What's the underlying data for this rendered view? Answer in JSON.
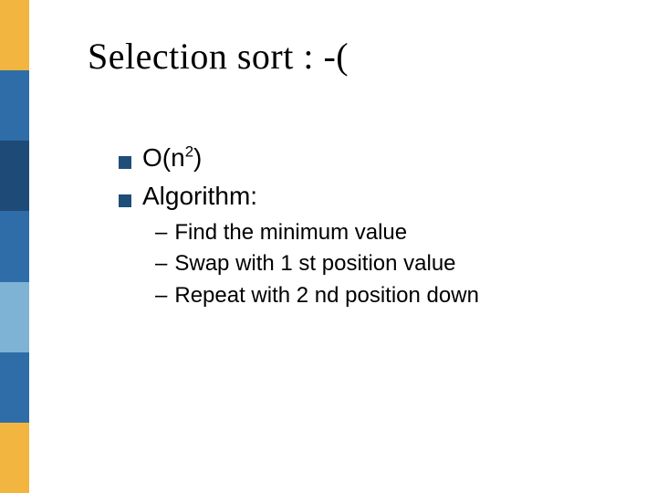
{
  "title": "Selection sort : -(",
  "bullets": {
    "b1": {
      "prefix": "O(n",
      "sup": "2",
      "suffix": ")"
    },
    "b2": "Algorithm:"
  },
  "subs": {
    "s1": "Find the minimum value",
    "s2": "Swap with 1 st position value",
    "s3": "Repeat with 2 nd position down"
  },
  "dash": "–"
}
